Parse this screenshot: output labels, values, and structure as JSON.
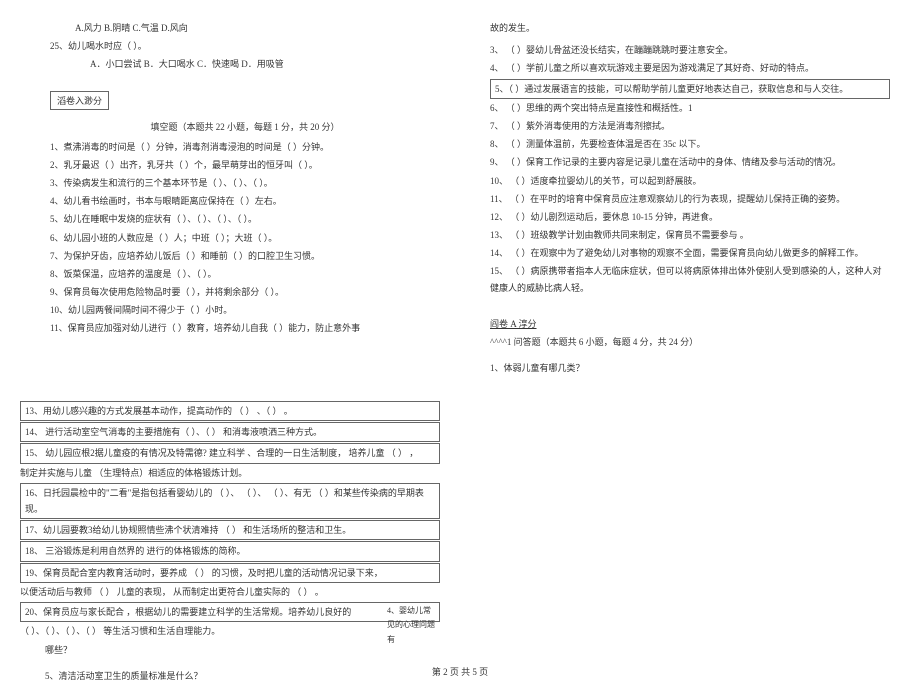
{
  "left": {
    "q24_options": "A.风力 B.阴晴 C.气温 D.风向",
    "q25": "25、幼儿喝水时应（ ）。",
    "q25_options": "A．小口尝试 B．大口喝水 C．快速喝 D．用吸管",
    "section2_title": "滔卷入渺分",
    "section2_sub": "填空题（本题共 22 小题，每题 1 分，共 20 分）",
    "fill": [
      "1、煮沸消毒的时间是（ ）分钟，消毒剂消毒浸泡的时间是（ ）分钟。",
      "2、乳牙最迟（ ）出齐，乳牙共（ ）个，最早萌芽出的恒牙叫（ ）。",
      "3、传染病发生和流行的三个基本环节是（ ）、（ ）、（ ）。",
      "4、幼儿看书绘画时，书本与眼睛距离应保持在（ ）左右。",
      "5、幼儿在睡眠中发烧的症状有（ ）、（ ）、（ ）、（ ）。",
      "6、幼儿园小班的人数应是（ ）人；中班（ ）；大班（ ）。",
      "7、为保护牙齿，应培养幼儿饭后（ ）和睡前（ ）的口腔卫生习惯。",
      "8、饭菜保温，应培养的温度是（ ）、（ ）。",
      "9、保育员每次使用危险物品时要（ ），并将剩余部分（ ）。",
      "10、幼儿园两餐间隔时间不得少于（ ）小时。",
      "11、保育员应加强对幼儿进行（  ）教育，培养幼儿自我（  ）能力，防止意外事"
    ]
  },
  "lower": {
    "items": [
      "13、用幼儿感兴趣的方式发展基本动作，提高动作的      （  ） 、（  ） 。",
      "14、  进行活动室空气消毒的主要措施有（        ）、（      ）  和消毒液喷洒三种方式。",
      "15、  幼儿园应根2据儿童疫的有情况及特需德?      建立科学 、合理的一日生活制度， 培养儿童       （       ）   ，",
      "制定并实施与儿童  （生理特点）相适应的体格锻炼计划。",
      "16、日托园晨检中的\"二看\"是指包括看婴幼儿的   （  ）、 （  ）、 （  ）、有无  （  ）和某些传染病的早期表现。",
      "17、幼儿园要教3给幼儿协规照情些沸个状清难持    （  ）  和生活场所的整洁和卫生。",
      "18、 三浴锻炼是利用自然界的                    进行的体格锻炼的简称。",
      "19、保育员配合室内教育活动时，要养成      （  ）  的习惯，及时把儿童的活动情况记录下来，",
      "以便活动后与教师  （  ）   儿童的表现， 从而制定出更符合儿童实际的  （  ）  。",
      "20、保育员应与家长配合 ，根据幼儿的需要建立科学的生活常规。培养幼儿良好的",
      "（  ）、（  ）、（  ）、（  ）    等生活习惯和生活自理能力。"
    ],
    "right_note": "4、婴幼儿常见的心理问题有",
    "q_which": "哪些？",
    "q5": "5、清洁活动室卫生的质量标准是什么？"
  },
  "right": {
    "pre": "故的发生。",
    "items": [
      "3、 （  ）婴幼儿骨盆还没长结实，在蹦蹦跳跳时要注意安全。",
      "4、 （  ）学前儿童之所以喜欢玩游戏主要是因为游戏满足了其好奇、好动的特点。",
      "5、（  ）通过发展语言的技能，可以帮助学前儿童更好地表达自己，获取信息和与人交往。",
      "6、 （  ）思维的两个突出特点是直接性和概括性。1",
      "7、 （  ）紫外消毒使用的方法是消毒剂擦拭。",
      "8、 （  ）测量体温前，先要检查体温是否在 35c 以下。",
      "9、 （  ）保育工作记录的主要内容是记录儿童在活动中的身体、情绪及参与活动的情况。",
      "10、  （  ）适度牵拉婴幼儿的关节，可以起到舒展肢。",
      "11、  （  ）在平时的培育中保育员应注意观察幼儿的行为表现，提醒幼儿保持正确的姿势。",
      "12、  （  ）幼儿剧烈运动后，要休息 10-15 分钟，再进食。",
      "13、  （  ）班级教学计划由教师共同来制定，保育员不需要参与 。",
      "14、  （  ）在观察中为了避免幼儿对事物的观察不全面，需要保育员向幼儿做更多的解释工作。",
      "15、  （  ）病原携带者指本人无临床症状，但可以将病原体排出体外使别人受到感染的人，这种人对健康人的威胁比病人轻。"
    ],
    "section3_title": "阎卷 A 淳分",
    "section3_sub": "^^^^1 问答题（本题共 6 小题，每题 4 分，共 24 分）",
    "q1": "1、体弱儿童有哪几类？"
  },
  "footer": "第 2 页 共 5 页"
}
